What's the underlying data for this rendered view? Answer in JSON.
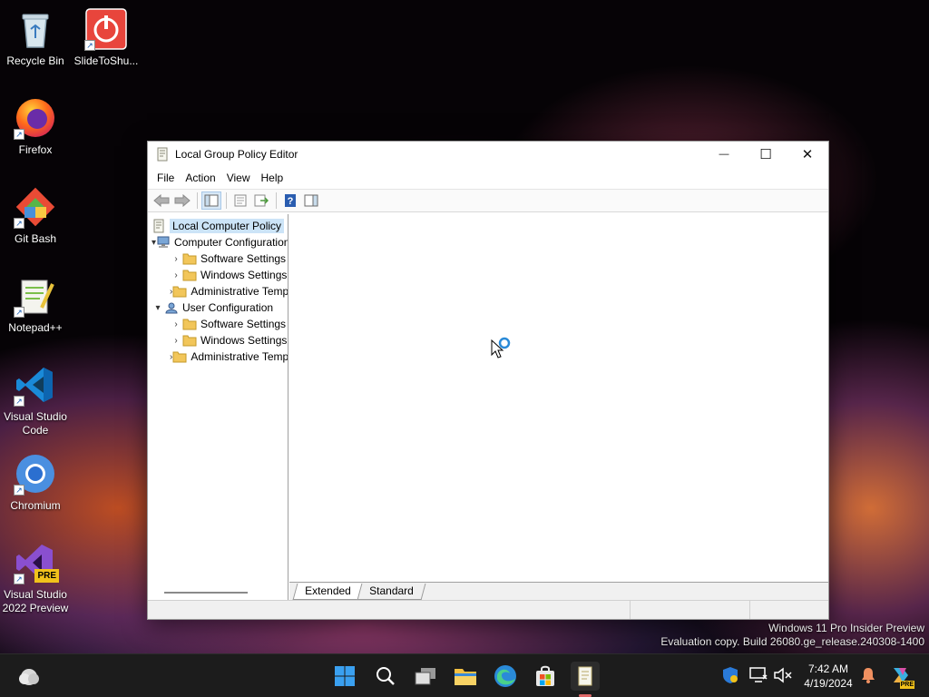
{
  "desktop": {
    "icons": [
      {
        "label": "Recycle Bin"
      },
      {
        "label": "SlideToShu..."
      },
      {
        "label": "Firefox"
      },
      {
        "label": "Git Bash"
      },
      {
        "label": "Notepad++"
      },
      {
        "label": "Visual Studio Code"
      },
      {
        "label": "Chromium"
      },
      {
        "label": "Visual Studio 2022 Preview",
        "badge": "PRE"
      }
    ]
  },
  "window": {
    "title": "Local Group Policy Editor",
    "controls": {
      "minimize": "—",
      "maximize": "☐",
      "close": "✕"
    },
    "menu": [
      "File",
      "Action",
      "View",
      "Help"
    ],
    "tree": [
      {
        "label": "Local Computer Policy",
        "level": 0,
        "selected": true,
        "icon": "policy-icon"
      },
      {
        "label": "Computer Configuration",
        "level": 1,
        "expanded": true,
        "icon": "computer-icon"
      },
      {
        "label": "Software Settings",
        "level": 2,
        "icon": "folder-icon"
      },
      {
        "label": "Windows Settings",
        "level": 2,
        "icon": "folder-icon"
      },
      {
        "label": "Administrative Templates",
        "level": 2,
        "icon": "folder-icon"
      },
      {
        "label": "User Configuration",
        "level": 1,
        "expanded": true,
        "icon": "user-icon"
      },
      {
        "label": "Software Settings",
        "level": 2,
        "icon": "folder-icon"
      },
      {
        "label": "Windows Settings",
        "level": 2,
        "icon": "folder-icon"
      },
      {
        "label": "Administrative Templates",
        "level": 2,
        "icon": "folder-icon"
      }
    ],
    "tabs": [
      "Extended",
      "Standard"
    ],
    "active_tab": "Extended"
  },
  "watermark": {
    "line1": "Windows 11 Pro Insider Preview",
    "line2": "Evaluation copy. Build 26080.ge_release.240308-1400"
  },
  "taskbar": {
    "time": "7:42 AM",
    "date": "4/19/2024",
    "copilot_badge": "PRE"
  },
  "colors": {
    "selection": "#cce4f7",
    "folder": "#e8b84a",
    "accent": "#0078d4"
  }
}
